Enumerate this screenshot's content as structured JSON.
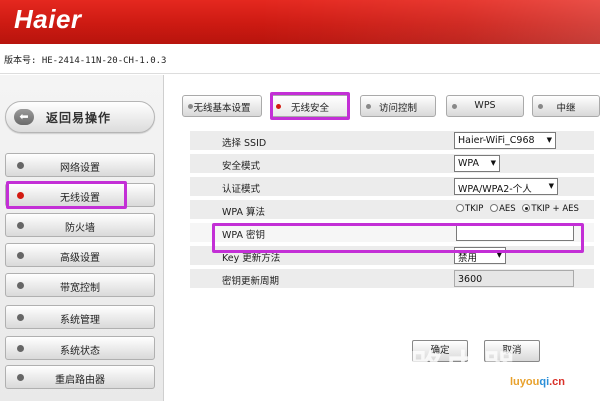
{
  "header": {
    "logo": "Haier"
  },
  "version": {
    "text": "版本号: HE-2414-11N-20-CH-1.0.3"
  },
  "sidebar": {
    "back_label": "返回易操作",
    "items": [
      {
        "label": "网络设置"
      },
      {
        "label": "无线设置",
        "active": true
      },
      {
        "label": "防火墙"
      },
      {
        "label": "高级设置"
      },
      {
        "label": "带宽控制"
      },
      {
        "label": "系统管理"
      },
      {
        "label": "系统状态"
      },
      {
        "label": "重启路由器"
      }
    ]
  },
  "tabs": [
    {
      "label": "无线基本设置"
    },
    {
      "label": "无线安全",
      "active": true
    },
    {
      "label": "访问控制"
    },
    {
      "label": "WPS"
    },
    {
      "label": "中继"
    }
  ],
  "form": {
    "ssid": {
      "label": "选择 SSID",
      "value": "Haier-WiFi_C968"
    },
    "security_mode": {
      "label": "安全模式",
      "value": "WPA"
    },
    "auth_mode": {
      "label": "认证模式",
      "value": "WPA/WPA2-个人"
    },
    "wpa_algorithm": {
      "label": "WPA 算法",
      "options": [
        "TKIP",
        "AES",
        "TKIP + AES"
      ],
      "selected": "TKIP + AES"
    },
    "wpa_key": {
      "label": "WPA 密钥",
      "value": ""
    },
    "key_update_method": {
      "label": "Key 更新方法",
      "value": "禁用"
    },
    "key_update_period": {
      "label": "密钥更新周期",
      "value": "3600"
    }
  },
  "actions": {
    "confirm_label": "确定",
    "cancel_label": "取消"
  },
  "watermark": {
    "text": "路由器",
    "url_a": "luyou",
    "url_b": "qi",
    "url_c": ".cn"
  },
  "colors": {
    "header_red": "#cc1a12",
    "highlight": "#c32fd6",
    "active_dot": "#d31a11"
  }
}
